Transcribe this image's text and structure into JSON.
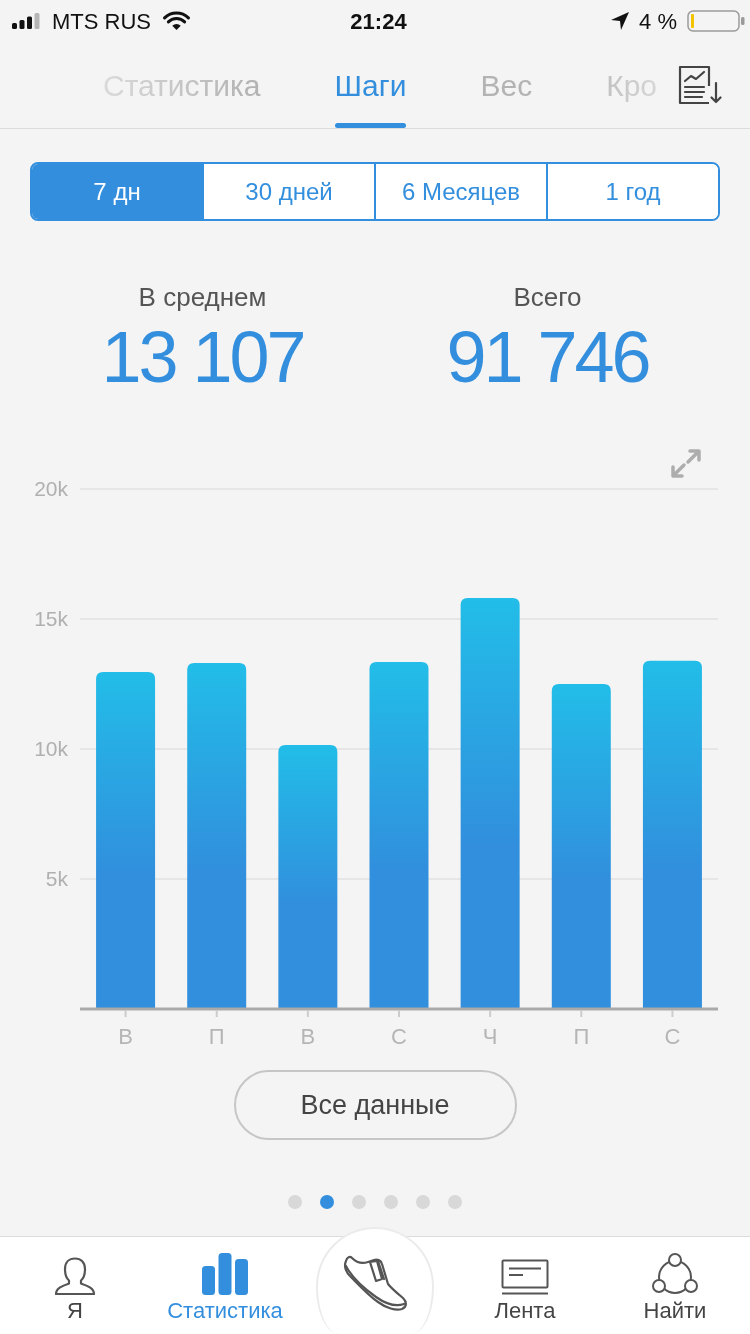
{
  "status_bar": {
    "carrier": "MTS RUS",
    "time": "21:24",
    "battery": "4 %"
  },
  "tabs": [
    {
      "label": "Статистика",
      "selected": false
    },
    {
      "label": "Шаги",
      "selected": true
    },
    {
      "label": "Вес",
      "selected": false
    },
    {
      "label": "Кро",
      "selected": false
    }
  ],
  "periods": [
    {
      "label": "7 дн",
      "selected": true
    },
    {
      "label": "30 дней",
      "selected": false
    },
    {
      "label": "6 Месяцев",
      "selected": false
    },
    {
      "label": "1 год",
      "selected": false
    }
  ],
  "summary": [
    {
      "label": "В среднем",
      "value": "13 107"
    },
    {
      "label": "Всего",
      "value": "91 746"
    }
  ],
  "chart_data": {
    "type": "bar",
    "categories": [
      "В",
      "П",
      "В",
      "С",
      "Ч",
      "П",
      "С"
    ],
    "values": [
      12960,
      13310,
      10150,
      13350,
      15810,
      12500,
      13390
    ],
    "ylim": [
      0,
      20000
    ],
    "yticks": [
      {
        "value": 5000,
        "label": "5k"
      },
      {
        "value": 10000,
        "label": "10k"
      },
      {
        "value": 15000,
        "label": "15k"
      },
      {
        "value": 20000,
        "label": "20k"
      }
    ],
    "grid": true
  },
  "all_data_button": {
    "label": "Все данные"
  },
  "pages": [
    {
      "selected": false
    },
    {
      "selected": true
    },
    {
      "selected": false
    },
    {
      "selected": false
    },
    {
      "selected": false
    },
    {
      "selected": false
    }
  ],
  "bottom_nav": [
    {
      "kind": "profile",
      "label": "Я",
      "selected": false
    },
    {
      "kind": "stats",
      "label": "Статистика",
      "selected": true
    },
    {
      "kind": "walk",
      "selected": false
    },
    {
      "kind": "feed",
      "label": "Лента",
      "selected": false
    },
    {
      "kind": "find",
      "label": "Найти",
      "selected": false
    }
  ]
}
